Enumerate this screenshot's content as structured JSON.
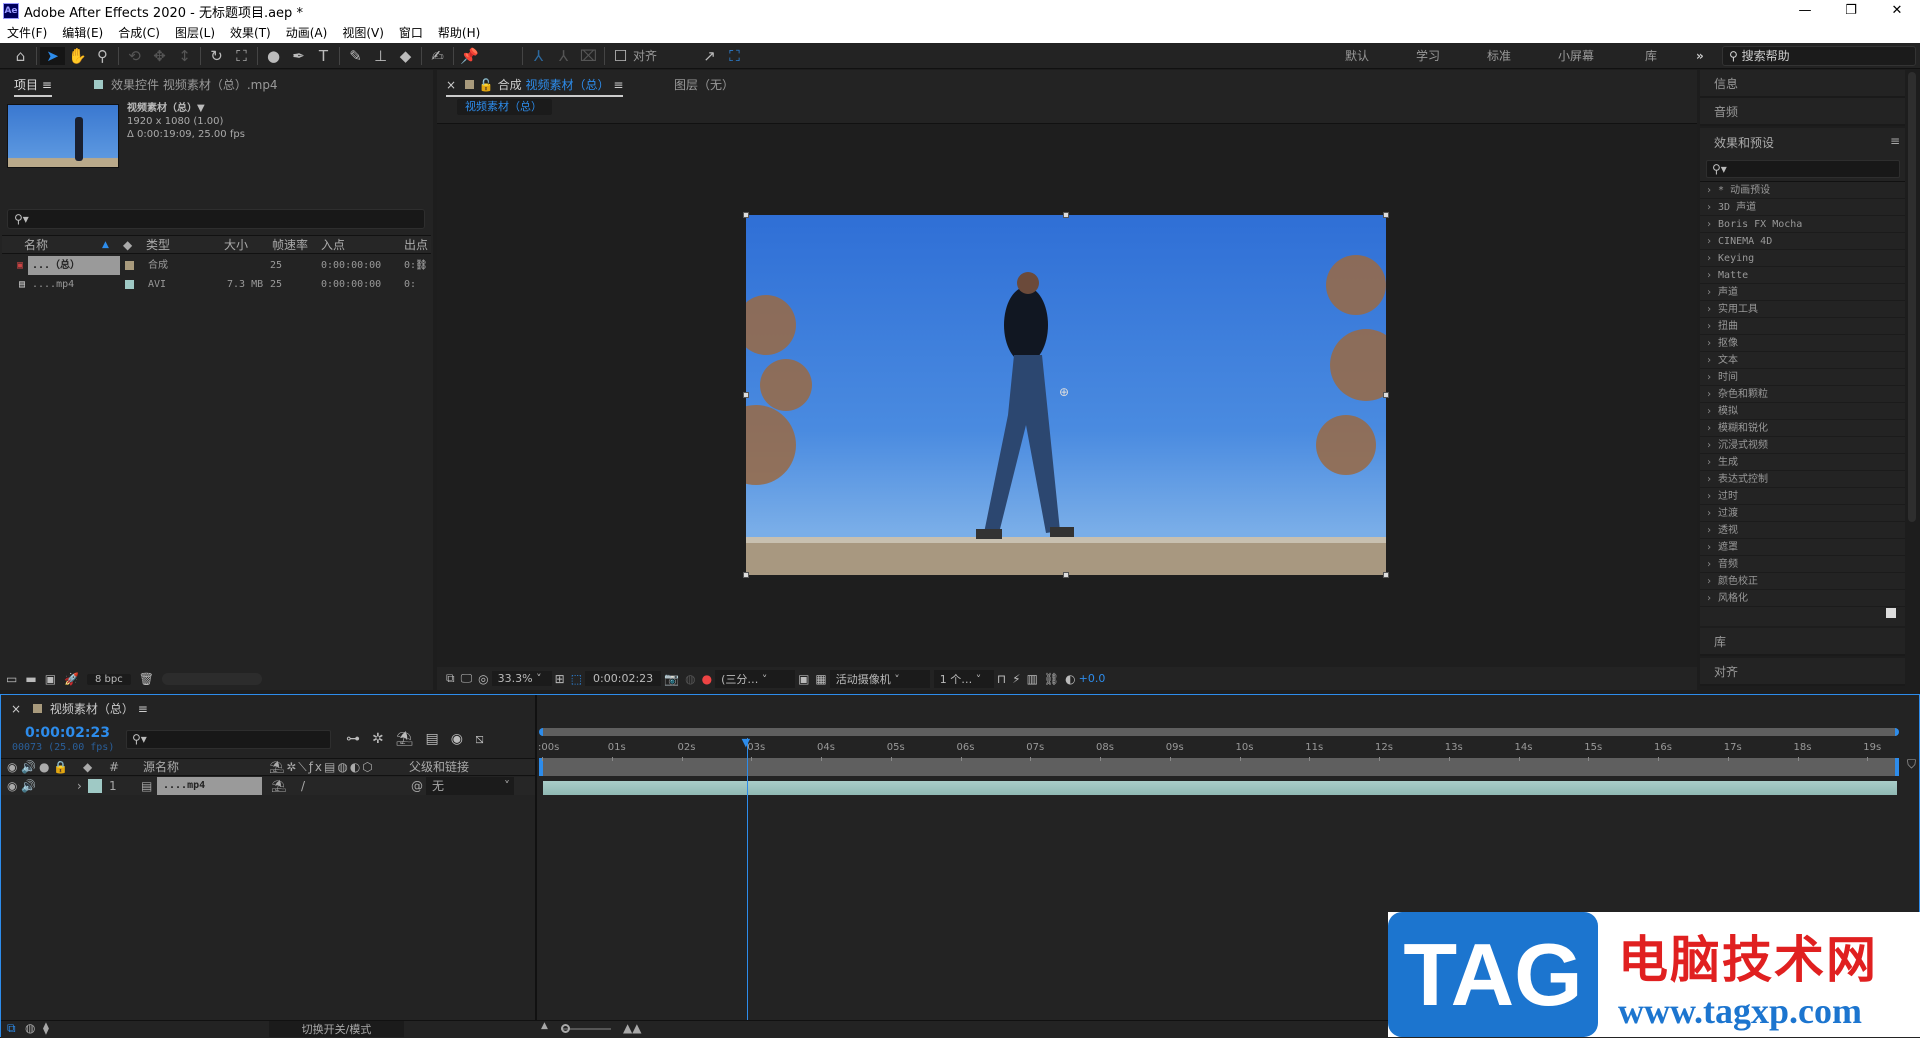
{
  "window": {
    "title": "Adobe After Effects 2020 - 无标题项目.aep *",
    "logo": "Ae",
    "controls": [
      "minimize-icon",
      "restore-icon",
      "close-icon"
    ]
  },
  "menu": [
    "文件(F)",
    "编辑(E)",
    "合成(C)",
    "图层(L)",
    "效果(T)",
    "动画(A)",
    "视图(V)",
    "窗口",
    "帮助(H)"
  ],
  "toolbar": {
    "align_label": "对齐",
    "workspaces": [
      "默认",
      "学习",
      "标准",
      "小屏幕",
      "库"
    ],
    "more": "»",
    "help_placeholder": "搜索帮助"
  },
  "project": {
    "tab": "项目",
    "effects_tab": "效果控件 视频素材（总）.mp4",
    "item_name": "视频素材（总）▼",
    "item_res": "1920 x 1080 (1.00)",
    "item_duration": "Δ 0:00:19:09, 25.00 fps",
    "columns": [
      "名称",
      "类型",
      "大小",
      "帧速率",
      "入点",
      "出点"
    ],
    "rows": [
      {
        "name": "...（总）",
        "type": "合成",
        "size": "",
        "fps": "25",
        "in": "0:00:00:00",
        "out": "0:",
        "color": "#a89a7c"
      },
      {
        "name": "....mp4",
        "type": "AVI",
        "size": "7.3 MB",
        "fps": "25",
        "in": "0:00:00:00",
        "out": "0:",
        "color": "#9fc9c5"
      }
    ],
    "bpc": "8 bpc"
  },
  "viewer": {
    "tab_prefix": "合成",
    "comp_name": "视频素材（总）",
    "layer_tab": "图层（无）",
    "breadcrumb": "视频素材（总）",
    "zoom": "33.3%",
    "timecode": "0:00:02:23",
    "resolution": "(三分…",
    "camera": "活动摄像机",
    "views": "1 个…",
    "exposure": "+0.0"
  },
  "right": {
    "info": "信息",
    "audio": "音频",
    "effects_title": "效果和预设",
    "effects": [
      "* 动画预设",
      "3D 声道",
      "Boris FX Mocha",
      "CINEMA 4D",
      "Keying",
      "Matte",
      "声道",
      "实用工具",
      "扭曲",
      "抠像",
      "文本",
      "时间",
      "杂色和颗粒",
      "模拟",
      "模糊和锐化",
      "沉浸式视频",
      "生成",
      "表达式控制",
      "过时",
      "过渡",
      "透视",
      "遮罩",
      "音频",
      "颜色校正",
      "风格化"
    ],
    "library": "库",
    "align": "对齐"
  },
  "timeline": {
    "comp_name": "视频素材（总）",
    "timecode": "0:00:02:23",
    "frames": "00073 (25.00 fps)",
    "columns": {
      "num": "#",
      "source": "源名称",
      "parent": "父级和链接"
    },
    "layer": {
      "num": "1",
      "name": "....mp4",
      "parent": "无",
      "color": "#9fc9c5"
    },
    "ticks": [
      ":00s",
      "01s",
      "02s",
      "03s",
      "04s",
      "05s",
      "06s",
      "07s",
      "08s",
      "09s",
      "10s",
      "11s",
      "12s",
      "13s",
      "14s",
      "15s",
      "16s",
      "17s",
      "18s",
      "19s"
    ],
    "current_time_seconds": 2.92,
    "toggle_label": "切换开关/模式"
  },
  "watermark": {
    "logo": "TAG",
    "site_name": "电脑技术网",
    "url": "www.tagxp.com"
  }
}
